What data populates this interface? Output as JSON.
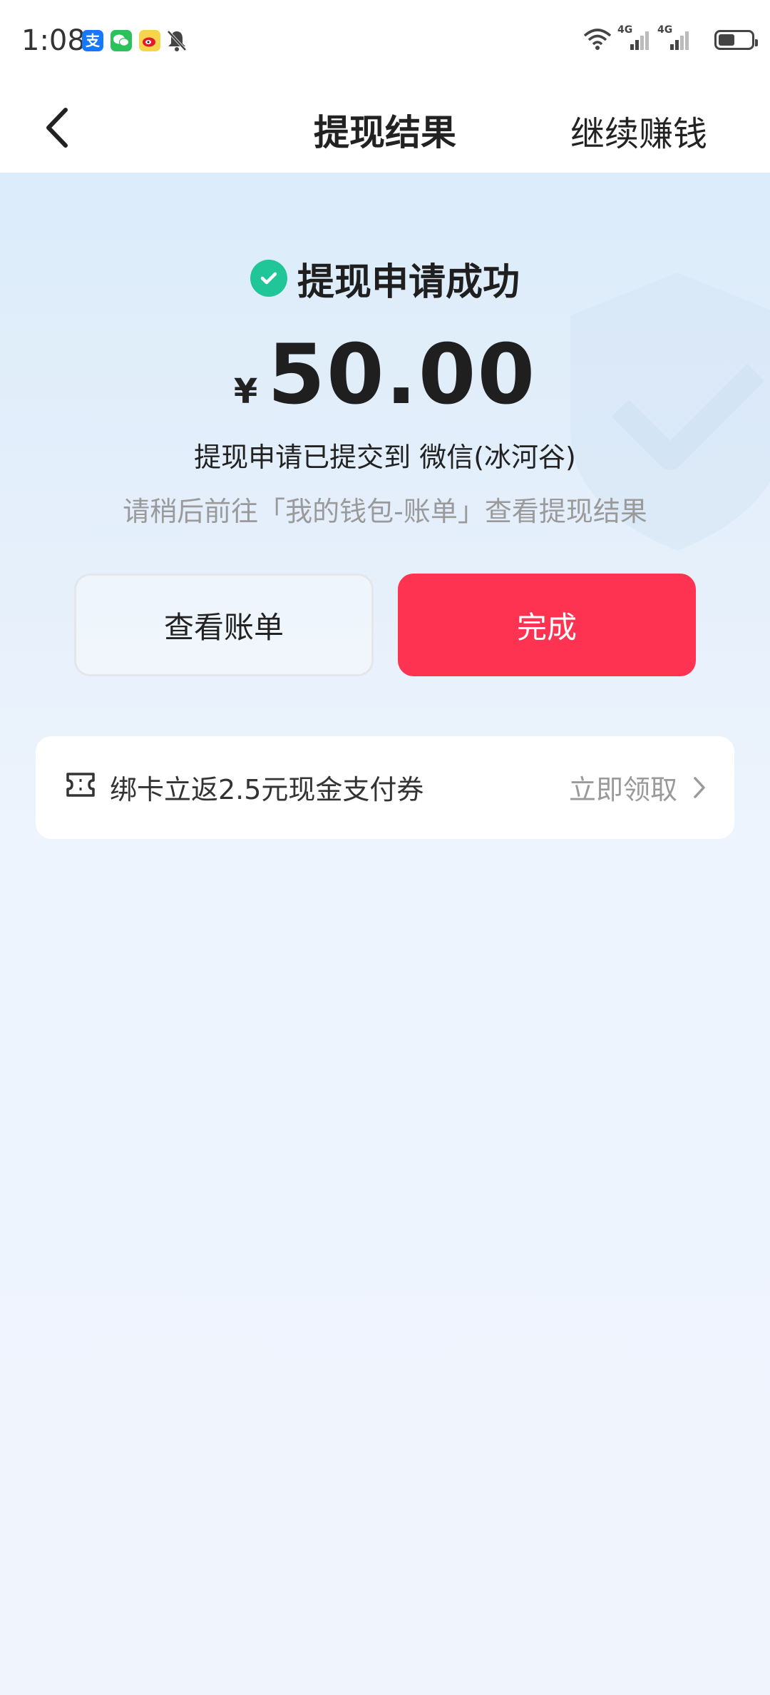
{
  "status_bar": {
    "time": "1:08",
    "apps": [
      {
        "name": "alipay-icon",
        "glyph": "支",
        "color": "#1677ff"
      },
      {
        "name": "wechat-icon",
        "glyph": "●",
        "color": "#2bc25b"
      },
      {
        "name": "weibo-icon",
        "glyph": "◎",
        "color": "#f0c33c"
      }
    ],
    "network_1": "4G",
    "network_2": "4G"
  },
  "nav": {
    "title": "提现结果",
    "right_action": "继续赚钱"
  },
  "result": {
    "status": "提现申请成功",
    "currency": "¥",
    "amount": "50.00",
    "submitted_to": "提现申请已提交到 微信(冰河谷)",
    "hint": "请稍后前往「我的钱包-账单」查看提现结果"
  },
  "buttons": {
    "view_bill": "查看账单",
    "done": "完成"
  },
  "promo": {
    "text": "绑卡立返2.5元现金支付券",
    "cta": "立即领取"
  },
  "colors": {
    "primary": "#fe3352",
    "success": "#20c598",
    "muted": "#9a9a9a"
  }
}
